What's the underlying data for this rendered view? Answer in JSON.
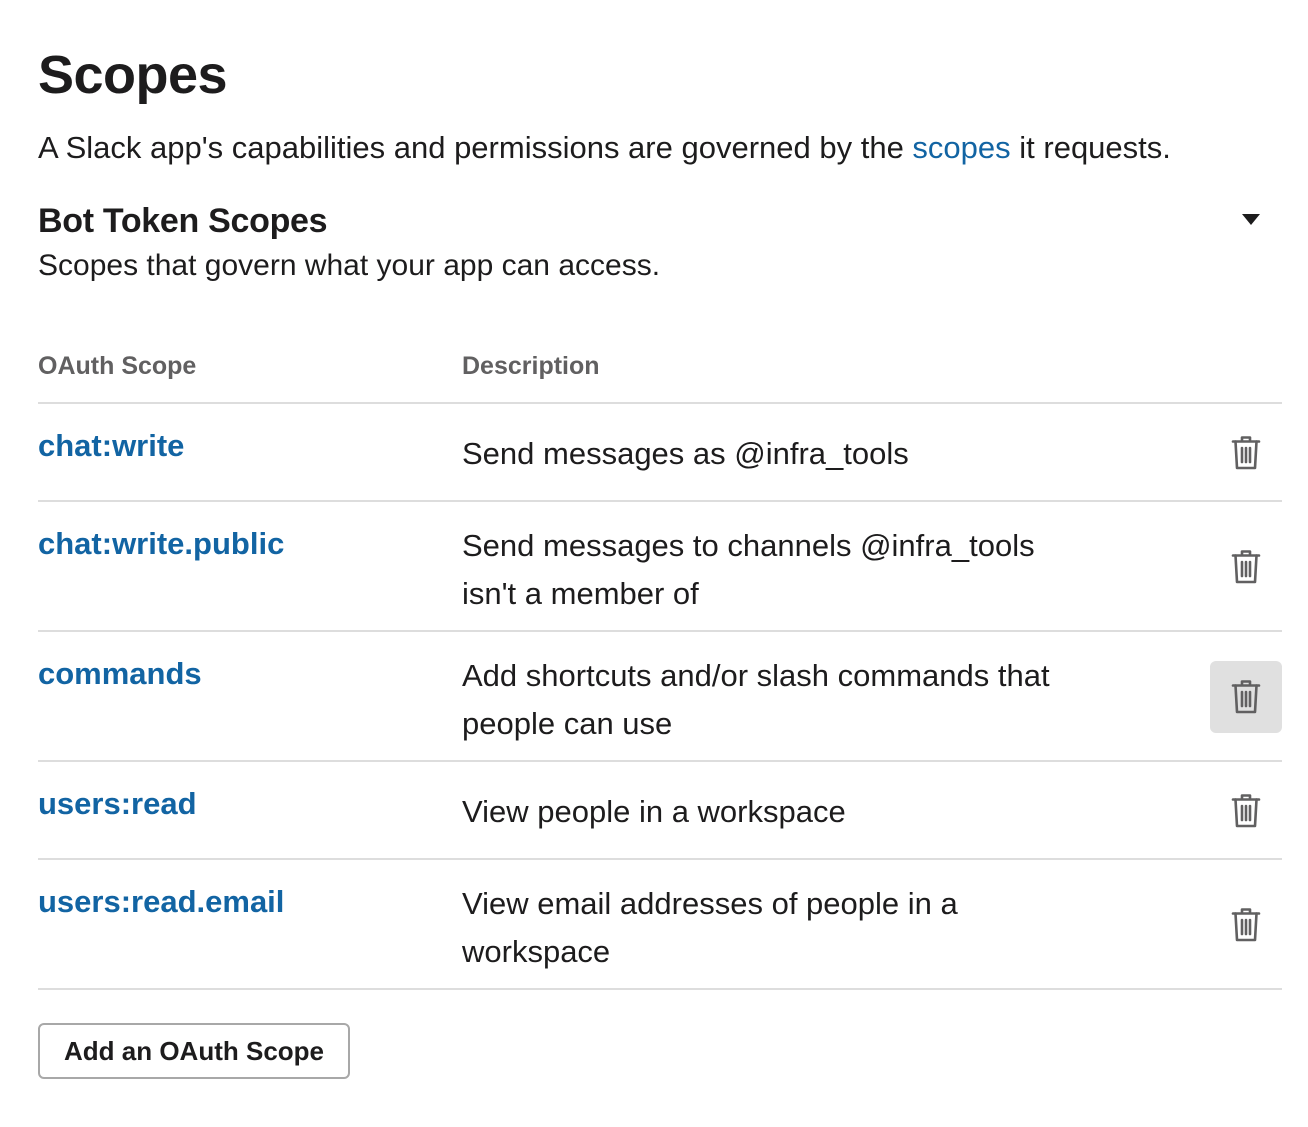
{
  "page": {
    "title": "Scopes",
    "intro_before": "A Slack app's capabilities and permissions are governed by the ",
    "intro_link": "scopes",
    "intro_after": " it requests."
  },
  "section": {
    "title": "Bot Token Scopes",
    "subtitle": "Scopes that govern what your app can access.",
    "collapse_icon": "caret-down-icon"
  },
  "table": {
    "headers": {
      "scope": "OAuth Scope",
      "description": "Description"
    },
    "rows": [
      {
        "scope": "chat:write",
        "description": "Send messages as @infra_tools",
        "action_icon": "trash-icon",
        "hovered": false
      },
      {
        "scope": "chat:write.public",
        "description": "Send messages to channels @infra_tools isn't a member of",
        "action_icon": "trash-icon",
        "hovered": false
      },
      {
        "scope": "commands",
        "description": "Add shortcuts and/or slash commands that people can use",
        "action_icon": "trash-icon",
        "hovered": true
      },
      {
        "scope": "users:read",
        "description": "View people in a workspace",
        "action_icon": "trash-icon",
        "hovered": false
      },
      {
        "scope": "users:read.email",
        "description": "View email addresses of people in a workspace",
        "action_icon": "trash-icon",
        "hovered": false
      }
    ]
  },
  "actions": {
    "add_scope_label": "Add an OAuth Scope"
  },
  "colors": {
    "link": "#1264a3",
    "text": "#1d1c1d",
    "muted": "#616061",
    "divider": "#dddddd",
    "hover_bg": "#e0e0e0"
  }
}
